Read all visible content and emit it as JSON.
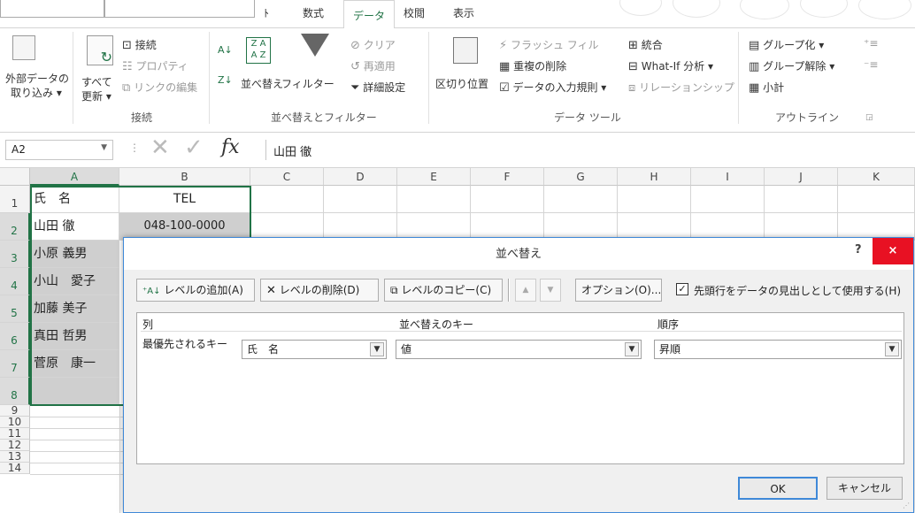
{
  "tabs": {
    "home_partial": "ﾄ",
    "formulas": "数式",
    "data": "データ",
    "review": "校閲",
    "view": "表示"
  },
  "ribbon": {
    "get_external": [
      "外部データの",
      "取り込み ▾"
    ],
    "refresh_all": [
      "すべて",
      "更新 ▾"
    ],
    "connections": "接続",
    "properties": "プロパティ",
    "edit_links": "リンクの編集",
    "group_connections": "接続",
    "sort_az": "A↓",
    "sort_za": "Z↓",
    "sort": "並べ替え",
    "filter": "フィルター",
    "clear": "クリア",
    "reapply": "再適用",
    "advanced": "詳細設定",
    "group_sort_filter": "並べ替えとフィルター",
    "text_to_columns": "区切り位置",
    "flash_fill": "フラッシュ フィル",
    "remove_duplicates": "重複の削除",
    "data_validation": "データの入力規則 ▾",
    "consolidate": "統合",
    "what_if": "What-If 分析 ▾",
    "relationships": "リレーションシップ",
    "group_data_tools": "データ ツール",
    "group": "グループ化 ▾",
    "ungroup": "グループ解除 ▾",
    "subtotal": "小計",
    "group_outline": "アウトライン"
  },
  "formula_bar": {
    "name_box": "A2",
    "fx": "fx",
    "value": "山田 徹"
  },
  "sheet": {
    "columns": [
      "A",
      "B",
      "C",
      "D",
      "E",
      "F",
      "G",
      "H",
      "I",
      "J",
      "K"
    ],
    "rows": [
      "1",
      "2",
      "3",
      "4",
      "5",
      "6",
      "7",
      "8",
      "9",
      "10",
      "11",
      "12",
      "13",
      "14"
    ],
    "cells": {
      "A1": "氏　名",
      "B1": "TEL",
      "A2": "山田 徹",
      "B2": "048-100-0000",
      "A3": "小原 義男",
      "A4": "小山　愛子",
      "A5": "加藤 美子",
      "A6": "真田 哲男",
      "A7": "菅原　康一"
    }
  },
  "dialog": {
    "title": "並べ替え",
    "help": "?",
    "close": "×",
    "add_level": "レベルの追加(A)",
    "delete_level": "レベルの削除(D)",
    "copy_level": "レベルのコピー(C)",
    "move_up": "▲",
    "move_down": "▼",
    "options": "オプション(O)...",
    "header_checkbox_label": "先頭行をデータの見出しとして使用する(H)",
    "header_checked": true,
    "col_header": "列",
    "key_header": "並べ替えのキー",
    "order_header": "順序",
    "row_label": "最優先されるキー",
    "column_value": "氏　名",
    "key_value": "値",
    "order_value": "昇順",
    "ok": "OK",
    "cancel": "キャンセル"
  },
  "colors": {
    "accent": "#217346",
    "close": "#e81123",
    "dialog_border": "#3f89d8"
  }
}
